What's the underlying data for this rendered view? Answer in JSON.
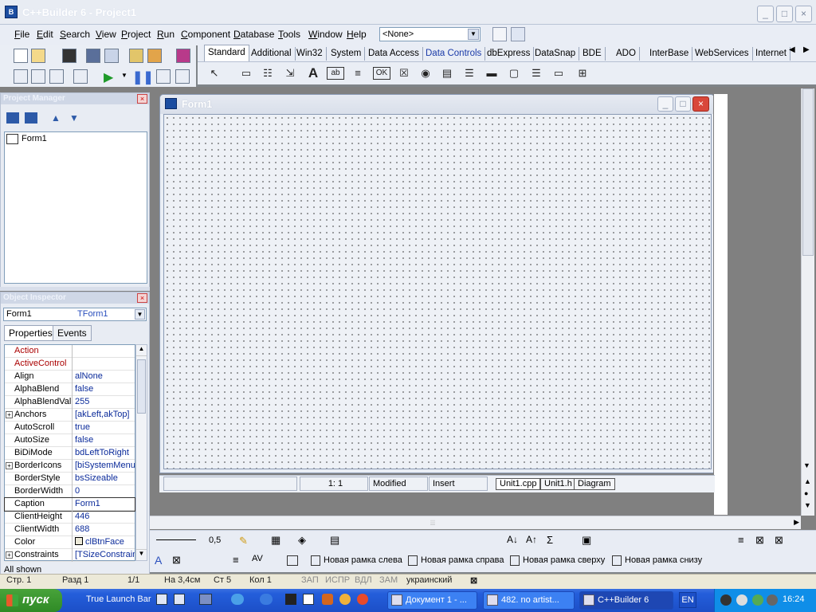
{
  "app": {
    "title": "C++Builder 6 - Project1"
  },
  "window_buttons": {
    "minimize": "_",
    "maximize": "□",
    "close": "×"
  },
  "menu": [
    {
      "label": "File",
      "hot": "F",
      "rest": "ile"
    },
    {
      "label": "Edit",
      "hot": "E",
      "rest": "dit"
    },
    {
      "label": "Search",
      "hot": "S",
      "rest": "earch"
    },
    {
      "label": "View",
      "hot": "V",
      "rest": "iew"
    },
    {
      "label": "Project",
      "hot": "P",
      "rest": "roject"
    },
    {
      "label": "Run",
      "hot": "R",
      "rest": "un"
    },
    {
      "label": "Component",
      "hot": "C",
      "rest": "omponent"
    },
    {
      "label": "Database",
      "hot": "D",
      "rest": "atabase"
    },
    {
      "label": "Tools",
      "hot": "T",
      "rest": "ools"
    },
    {
      "label": "Window",
      "hot": "W",
      "rest": "indow"
    },
    {
      "label": "Help",
      "hot": "H",
      "rest": "elp"
    }
  ],
  "config_combo": {
    "value": "<None>"
  },
  "palette_tabs": [
    "Standard",
    "Additional",
    "Win32",
    "System",
    "Data Access",
    "Data Controls",
    "dbExpress",
    "DataSnap",
    "BDE",
    "ADO",
    "InterBase",
    "WebServices",
    "Internet"
  ],
  "palette_active": "Standard",
  "palette_icons": [
    "pointer-icon",
    "frames-icon",
    "main-menu-icon",
    "popup-menu-icon",
    "label-icon",
    "edit-icon",
    "memo-icon",
    "button-icon",
    "checkbox-icon",
    "radiobutton-icon",
    "listbox-icon",
    "combobox-icon",
    "scrollbar-icon",
    "groupbox-icon",
    "radiogroup-icon",
    "panel-icon",
    "actionlist-icon"
  ],
  "project_manager": {
    "title": "Project Manager",
    "item": "Form1"
  },
  "object_inspector": {
    "title": "Object Inspector",
    "object_name": "Form1",
    "object_type": "TForm1",
    "tabs": [
      "Properties",
      "Events"
    ],
    "properties": [
      {
        "name": "Action",
        "value": "",
        "red": true,
        "expand": false
      },
      {
        "name": "ActiveControl",
        "value": "",
        "red": true,
        "expand": false
      },
      {
        "name": "Align",
        "value": "alNone",
        "red": false,
        "expand": false
      },
      {
        "name": "AlphaBlend",
        "value": "false",
        "red": false,
        "expand": false
      },
      {
        "name": "AlphaBlendValue",
        "value": "255",
        "red": false,
        "expand": false
      },
      {
        "name": "Anchors",
        "value": "[akLeft,akTop]",
        "red": false,
        "expand": true
      },
      {
        "name": "AutoScroll",
        "value": "true",
        "red": false,
        "expand": false
      },
      {
        "name": "AutoSize",
        "value": "false",
        "red": false,
        "expand": false
      },
      {
        "name": "BiDiMode",
        "value": "bdLeftToRight",
        "red": false,
        "expand": false
      },
      {
        "name": "BorderIcons",
        "value": "[biSystemMenu,",
        "red": false,
        "expand": true
      },
      {
        "name": "BorderStyle",
        "value": "bsSizeable",
        "red": false,
        "expand": false
      },
      {
        "name": "BorderWidth",
        "value": "0",
        "red": false,
        "expand": false
      },
      {
        "name": "Caption",
        "value": "Form1",
        "red": false,
        "expand": false
      },
      {
        "name": "ClientHeight",
        "value": "446",
        "red": false,
        "expand": false
      },
      {
        "name": "ClientWidth",
        "value": "688",
        "red": false,
        "expand": false
      },
      {
        "name": "Color",
        "value": "clBtnFace",
        "red": false,
        "expand": false
      },
      {
        "name": "Constraints",
        "value": "[TSizeConstrain",
        "red": false,
        "expand": true
      }
    ],
    "footer": "All shown"
  },
  "form1": {
    "caption": "Form1"
  },
  "editor_status": {
    "position": "1:   1",
    "modified": "Modified",
    "mode": "Insert"
  },
  "file_tabs": [
    "Unit1.cpp",
    "Unit1.h",
    "Diagram"
  ],
  "word_toolbar": {
    "line_width": "0,5",
    "buttons": [
      "Новая рамка слева",
      "Новая рамка справа",
      "Новая рамка сверху",
      "Новая рамка снизу"
    ]
  },
  "word_status": {
    "page": "Стр. 1",
    "section": "Разд 1",
    "pages": "1/1",
    "at": "На 3,4см",
    "line": "Ст 5",
    "col": "Кол 1",
    "rec": "ЗАП",
    "trk": "ИСПР",
    "ext": "ВДЛ",
    "ovr": "ЗАМ",
    "language": "украинский"
  },
  "taskbar": {
    "start": "пуск",
    "quicklaunch": "True Launch Bar",
    "tasks": [
      "Документ 1 - ...",
      "482. no artist...",
      "C++Builder 6"
    ],
    "lang": "EN",
    "clock": "16:24"
  },
  "colors": {
    "accent": "#245edb",
    "start": "#3c9a2e",
    "property_value": "#0a2a9a",
    "property_red": "#aa0000"
  }
}
